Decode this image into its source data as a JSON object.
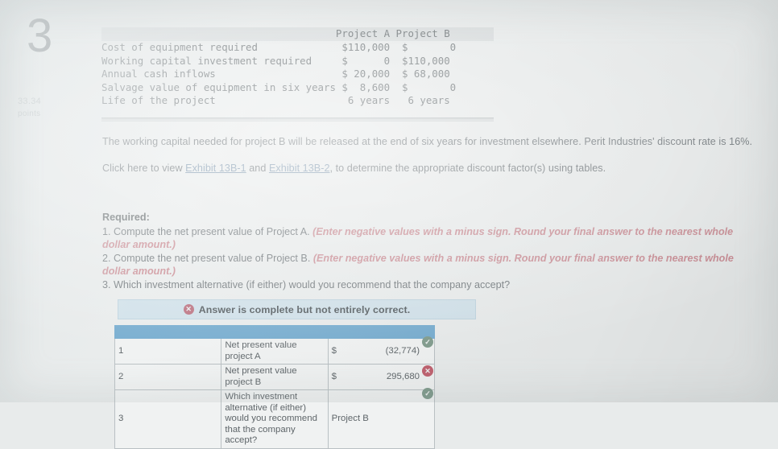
{
  "question": {
    "number": "3",
    "points_value": "33.34",
    "points_label": "points"
  },
  "data_table": {
    "header": "                                       Project A Project B",
    "rows": [
      "Cost of equipment required              $110,000  $       0",
      "Working capital investment required     $      0  $110,000",
      "Annual cash inflows                     $ 20,000  $ 68,000",
      "Salvage value of equipment in six years $  8,600  $       0",
      "Life of the project                      6 years   6 years"
    ],
    "columns": [
      "",
      "Project A",
      "Project B"
    ],
    "line_items": [
      {
        "label": "Cost of equipment required",
        "project_a": "$110,000",
        "project_b": "$       0"
      },
      {
        "label": "Working capital investment required",
        "project_a": "$      0",
        "project_b": "$110,000"
      },
      {
        "label": "Annual cash inflows",
        "project_a": "$ 20,000",
        "project_b": "$ 68,000"
      },
      {
        "label": "Salvage value of equipment in six years",
        "project_a": "$  8,600",
        "project_b": "$       0"
      },
      {
        "label": "Life of the project",
        "project_a": "6 years",
        "project_b": "6 years"
      }
    ]
  },
  "body": {
    "paragraph_1": "The working capital needed for project B will be released at the end of six years for investment elsewhere. Perit Industries' discount rate is 16%.",
    "click_prefix": "Click here to view ",
    "link_1": "Exhibit 13B-1",
    "link_joiner": " and ",
    "link_2": "Exhibit 13B-2",
    "click_suffix": ", to determine the appropriate discount factor(s) using tables."
  },
  "required": {
    "title": "Required:",
    "item_1_text": "1. Compute the net present value of Project A. ",
    "item_1_note": "(Enter negative values with a minus sign. Round your final answer to the nearest whole dollar amount.)",
    "item_2_text": "2. Compute the net present value of Project B. ",
    "item_2_note": "(Enter negative values with a minus sign. Round your final answer to the nearest whole dollar amount.)",
    "item_3_text": "3. Which investment alternative (if either) would you recommend that the company accept?"
  },
  "answer": {
    "banner_text": "Answer is complete but not entirely correct.",
    "banner_icon": "x-circle-icon",
    "rows": [
      {
        "index": "1",
        "description": "Net present value project A",
        "currency": "$",
        "value": "(32,774)",
        "plain_value": "",
        "status": "correct",
        "status_icon": "check-circle-icon"
      },
      {
        "index": "2",
        "description": "Net present value project B",
        "currency": "$",
        "value": "295,680",
        "plain_value": "",
        "status": "incorrect",
        "status_icon": "x-circle-icon"
      },
      {
        "index": "3",
        "description": "Which investment alternative (if either) would you recommend that the company accept?",
        "currency": "",
        "value": "",
        "plain_value": "Project B",
        "status": "correct",
        "status_icon": "check-circle-icon"
      }
    ]
  },
  "colors": {
    "page_background": "#e8ebeb",
    "table_header_band": "#d7dbdc",
    "link": "#7d96ad",
    "required_note": "#c98b93",
    "banner_background": "#cfe0e9",
    "answer_header_blue": "#72aace",
    "status_correct": "#7e9a8b",
    "status_incorrect": "#c0616f"
  }
}
